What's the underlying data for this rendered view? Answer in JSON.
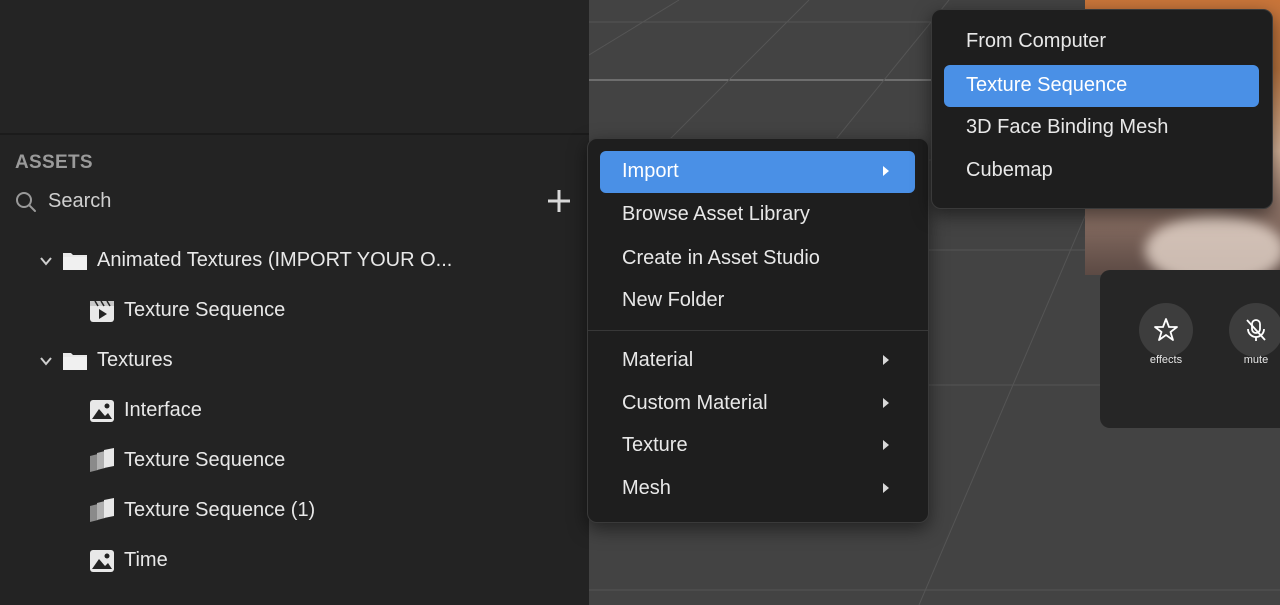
{
  "assets_panel": {
    "title": "ASSETS",
    "search": {
      "placeholder": "Search",
      "value": ""
    },
    "add_icon": "plus-icon",
    "tree": [
      {
        "label": "Animated Textures (IMPORT YOUR O...",
        "icon": "folder-icon",
        "expanded": true,
        "level": 0
      },
      {
        "label": "Texture Sequence",
        "icon": "animated-texture-icon",
        "level": 1
      },
      {
        "label": "Textures",
        "icon": "folder-icon",
        "expanded": true,
        "level": 0
      },
      {
        "label": "Interface",
        "icon": "image-icon",
        "level": 1
      },
      {
        "label": "Texture Sequence",
        "icon": "texture-sequence-icon",
        "level": 1
      },
      {
        "label": "Texture Sequence (1)",
        "icon": "texture-sequence-icon",
        "level": 1
      },
      {
        "label": "Time",
        "icon": "image-icon",
        "level": 1
      }
    ]
  },
  "context_menu": {
    "items": [
      {
        "label": "Import",
        "has_submenu": true,
        "selected": true
      },
      {
        "label": "Browse Asset Library",
        "has_submenu": false
      },
      {
        "label": "Create in Asset Studio",
        "has_submenu": false
      },
      {
        "label": "New Folder",
        "has_submenu": false
      },
      {
        "label": "Material",
        "has_submenu": true
      },
      {
        "label": "Custom Material",
        "has_submenu": true
      },
      {
        "label": "Texture",
        "has_submenu": true
      },
      {
        "label": "Mesh",
        "has_submenu": true
      }
    ]
  },
  "import_submenu": {
    "items": [
      {
        "label": "From Computer"
      },
      {
        "label": "Texture Sequence",
        "selected": true
      },
      {
        "label": "3D Face Binding Mesh"
      },
      {
        "label": "Cubemap"
      }
    ]
  },
  "call_controls": {
    "effects_label": "effects",
    "mute_label": "mute"
  },
  "colors": {
    "accent": "#4a90e6",
    "panel": "#232323",
    "viewport": "#434343",
    "menu_bg": "#1e1e1e"
  }
}
